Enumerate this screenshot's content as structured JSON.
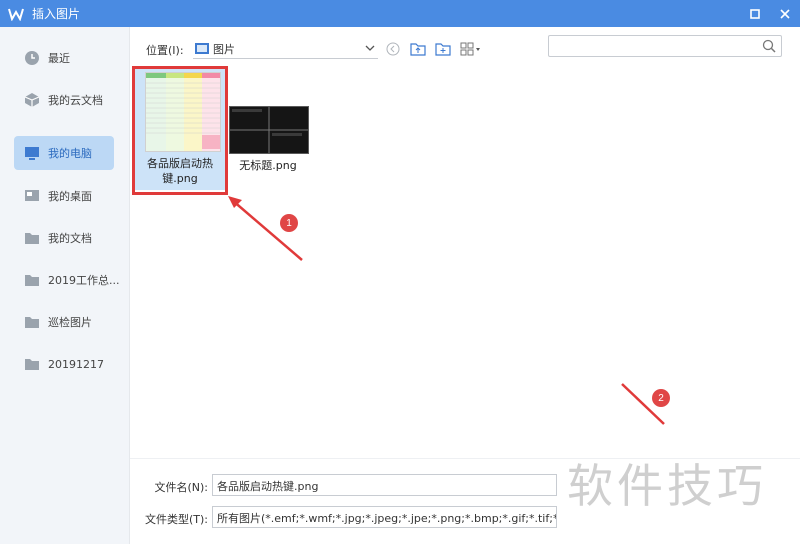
{
  "window": {
    "title": "插入图片"
  },
  "sidebar": {
    "items": [
      {
        "label": "最近",
        "icon": "clock-icon"
      },
      {
        "label": "我的云文档",
        "icon": "cloud-cube-icon"
      },
      {
        "label": "我的电脑",
        "icon": "monitor-icon",
        "active": true
      },
      {
        "label": "我的桌面",
        "icon": "desktop-icon"
      },
      {
        "label": "我的文档",
        "icon": "folder-icon"
      },
      {
        "label": "2019工作总...",
        "icon": "folder-icon"
      },
      {
        "label": "巡检图片",
        "icon": "folder-icon"
      },
      {
        "label": "20191217",
        "icon": "folder-icon"
      }
    ]
  },
  "toolbar": {
    "location_label": "位置(I):",
    "location_value": "图片"
  },
  "search": {
    "placeholder": ""
  },
  "files": [
    {
      "name": "各品版启动热键.png",
      "selected": true
    },
    {
      "name": "无标题.png",
      "selected": false
    }
  ],
  "footer": {
    "filename_label": "文件名(N):",
    "filename_value": "各品版启动热键.png",
    "filetype_label": "文件类型(T):",
    "filetype_value": "所有图片(*.emf;*.wmf;*.jpg;*.jpeg;*.jpe;*.png;*.bmp;*.gif;*.tif;*.tiff;*.wdp;*.svg"
  },
  "annotations": {
    "badge1": "1",
    "badge2": "2"
  },
  "watermark": "软件技巧",
  "colors": {
    "titlebar": "#4a8be2",
    "accent_red": "#e03a3a",
    "selected": "#cde3f8",
    "sidebar_active": "#bcd8f5"
  }
}
